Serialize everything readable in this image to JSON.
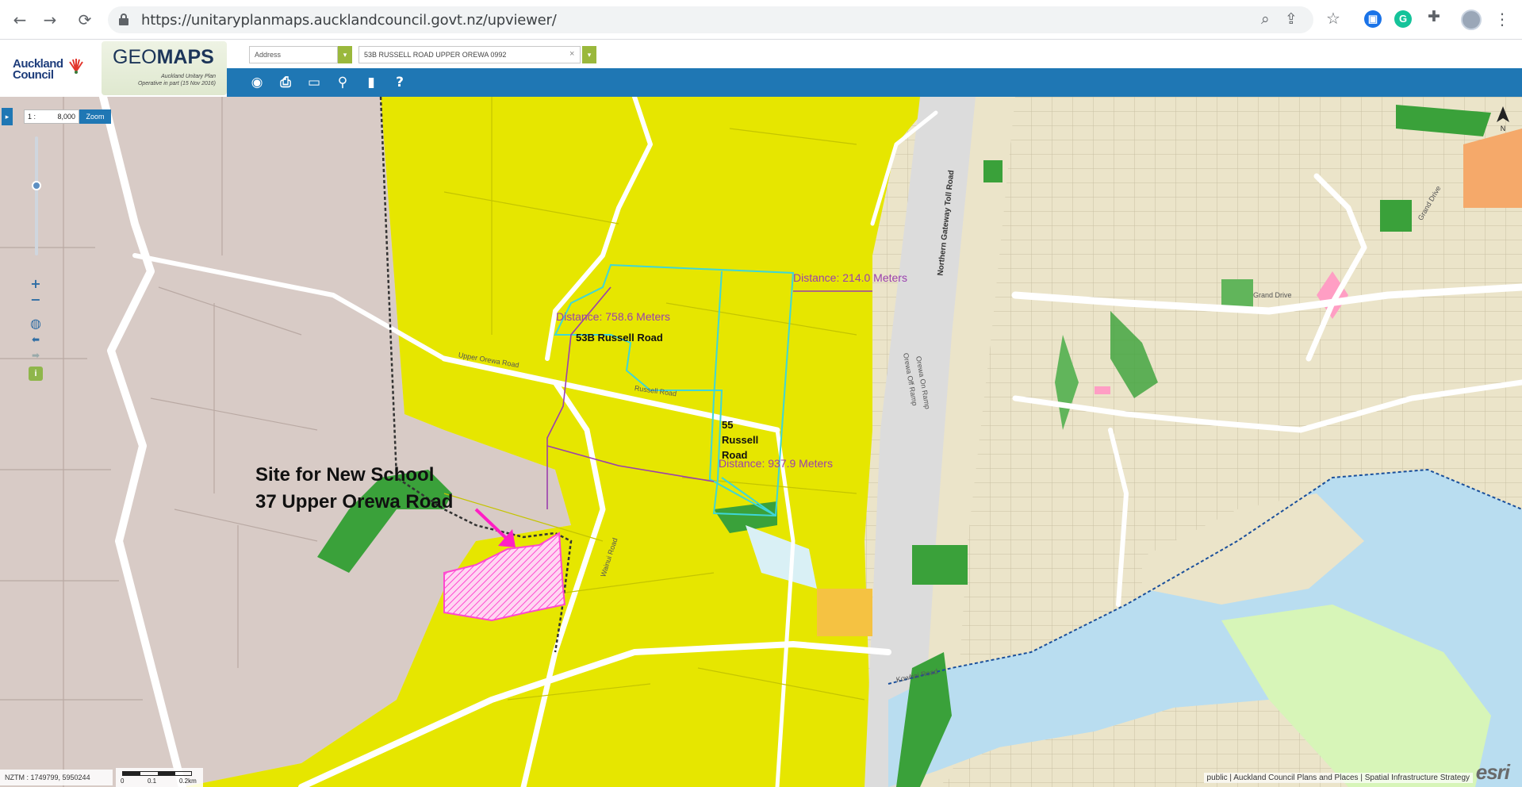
{
  "browser": {
    "url": "https://unitaryplanmaps.aucklandcouncil.govt.nz/upviewer/",
    "nav": {
      "back": "←",
      "forward": "→",
      "reload": "⟳"
    },
    "icons": [
      "zoom-icon",
      "share-icon",
      "star-icon",
      "extension-blue-icon",
      "grammarly-icon",
      "puzzle-icon"
    ],
    "ext_labels": {
      "blue": "▣",
      "green": "G"
    },
    "kebab": "⋮"
  },
  "header": {
    "council_logo_text": "Auckland Council",
    "app_logo_prefix": "GEO",
    "app_logo_bold": "MAPS",
    "app_logo_sub_line1": "Auckland Unitary Plan",
    "app_logo_sub_line2": "Operative in part (15 Nov 2016)",
    "search_type": "Address",
    "search_value": "53B RUSSELL ROAD UPPER OREWA 0992",
    "clear_symbol": "×",
    "dropdown_symbol": "▾",
    "tools": {
      "view": "◉",
      "print": "⎙",
      "measure": "▭",
      "locate": "⚲",
      "bookmark": "▮",
      "help": "?"
    }
  },
  "map": {
    "controls": {
      "panel_toggle": "▸",
      "scale_prefix": "1 :",
      "scale_value": "8,000",
      "zoom_label": "Zoom",
      "zoom_in": "+",
      "zoom_out": "−",
      "globe": "◍",
      "prev": "⬅",
      "next": "➡",
      "info": "i"
    },
    "measurements": [
      {
        "label": "Distance: 214.0 Meters"
      },
      {
        "label": "Distance: 758.6 Meters"
      },
      {
        "label": "Distance: 937.9 Meters"
      }
    ],
    "properties": [
      {
        "label": "53B Russell Road"
      },
      {
        "label": "55 Russell Road"
      }
    ],
    "annotation": {
      "line1": "Site for New School",
      "line2": "37 Upper Orewa Road"
    },
    "road_labels": [
      "Northern Gateway Toll Road",
      "Orewa Off Ramp",
      "Orewa On Ramp",
      "Grand Drive",
      "Russell Road",
      "Upper Orewa Road",
      "Wainui Road",
      "Grand Drive",
      "Kowhai Road"
    ],
    "coordinates": "NZTM : 1749799, 5950244",
    "scalebar_ticks": [
      "0",
      "0.1",
      "0.2km"
    ],
    "attribution": "public | Auckland Council Plans and Places | Spatial Infrastructure Strategy",
    "esri": "esri",
    "north": "N"
  },
  "colors": {
    "zone_yellow": "#e6e600",
    "zone_rural_pink": "#d8cbc6",
    "zone_residential": "#ebe4c9",
    "zone_green": "#3aa13a",
    "water": "#b9ddf0",
    "school_hatch": "#ff48d0",
    "measure_purple": "#9a3fae",
    "parcel_cyan": "#3fd6d6",
    "toolbar_blue": "#1f77b4"
  }
}
